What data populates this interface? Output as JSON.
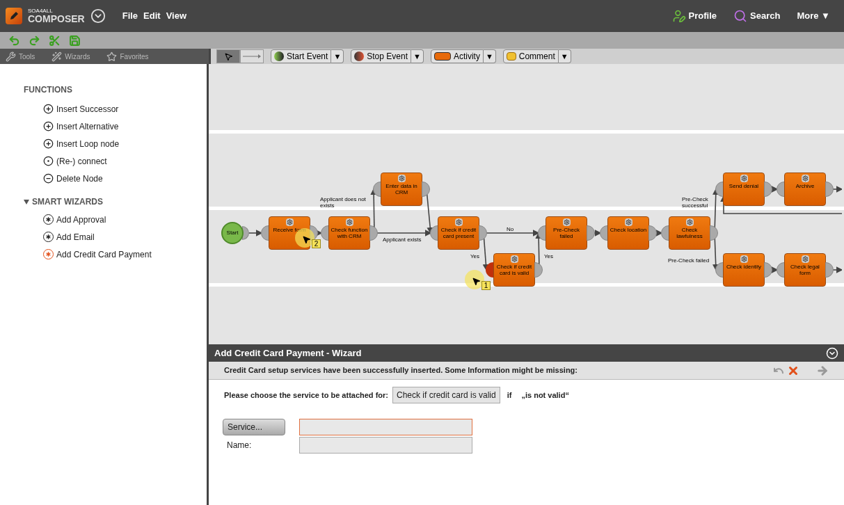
{
  "header": {
    "logo_top": "SOA4ALL",
    "logo_bottom": "COMPOSER",
    "menu": [
      "File",
      "Edit",
      "View"
    ],
    "links": [
      {
        "kind": "profile",
        "label": "Profile"
      },
      {
        "kind": "search",
        "label": "Search"
      },
      {
        "kind": "more",
        "label": "More ▼"
      }
    ]
  },
  "toolbar": [
    {
      "kind": "undo"
    },
    {
      "kind": "redo"
    },
    {
      "kind": "cut"
    },
    {
      "kind": "save"
    }
  ],
  "panel_tabs": [
    {
      "kind": "tools",
      "label": "Tools"
    },
    {
      "kind": "wizards",
      "label": "Wizards"
    },
    {
      "kind": "favorites",
      "label": "Favorites"
    }
  ],
  "palette": {
    "modes": [
      {
        "kind": "pointer",
        "selected": true
      },
      {
        "kind": "connector",
        "selected": false
      }
    ],
    "items": [
      {
        "kind": "start",
        "label": "Start Event"
      },
      {
        "kind": "stop",
        "label": "Stop Event"
      },
      {
        "kind": "activity",
        "label": "Activity"
      },
      {
        "kind": "comment",
        "label": "Comment"
      }
    ],
    "dropdown": "▼"
  },
  "sidebar": {
    "functions_title": "FUNCTIONS",
    "functions": [
      {
        "kind": "plus",
        "label": "Insert Successor"
      },
      {
        "kind": "plus",
        "label": "Insert Alternative"
      },
      {
        "kind": "plus",
        "label": "Insert Loop node"
      },
      {
        "kind": "ring",
        "label": "(Re-) connect"
      },
      {
        "kind": "minus",
        "label": "Delete Node"
      }
    ],
    "wizards_title": "SMART WIZARDS",
    "wizards_expanded": true,
    "wizards": [
      {
        "label": "Add Approval",
        "selected": false
      },
      {
        "label": "Add Email",
        "selected": false
      },
      {
        "label": "Add Credit Card Payment",
        "selected": true
      }
    ]
  },
  "diagram": {
    "start": "Start",
    "nodes": [
      {
        "label": "Receive form",
        "highlighted": false
      },
      {
        "label": "Check function with CRM",
        "highlighted": false
      },
      {
        "label": "Enter data in CRM",
        "highlighted": false
      },
      {
        "label": "Check if credit card present",
        "highlighted": false
      },
      {
        "label": "Check if credit card is valid",
        "highlighted": true
      },
      {
        "label": "Pre-Check failed",
        "highlighted": false
      },
      {
        "label": "Check location",
        "highlighted": false
      },
      {
        "label": "Check lawfulness",
        "highlighted": false
      },
      {
        "label": "Send denial",
        "highlighted": false
      },
      {
        "label": "Archive",
        "highlighted": false
      },
      {
        "label": "Check identity",
        "highlighted": false
      },
      {
        "label": "Check legal form",
        "highlighted": false
      }
    ],
    "edge_labels": [
      "Applicant does not exists",
      "Applicant exists",
      "No",
      "Yes",
      "Yes",
      "Pre-Check successful",
      "Pre-Check failed"
    ],
    "markers": [
      "2",
      "1"
    ]
  },
  "wizard": {
    "title": "Add Credit Card Payment - Wizard",
    "message": "Credit Card setup services have been successfully inserted. Some Information might be missing:",
    "prompt": "Please choose the service to be attached for:",
    "service_value": "Check if credit card is valid",
    "if_word": "if",
    "condition": "„is not valid“",
    "service_button": "Service...",
    "name_label": "Name:"
  }
}
